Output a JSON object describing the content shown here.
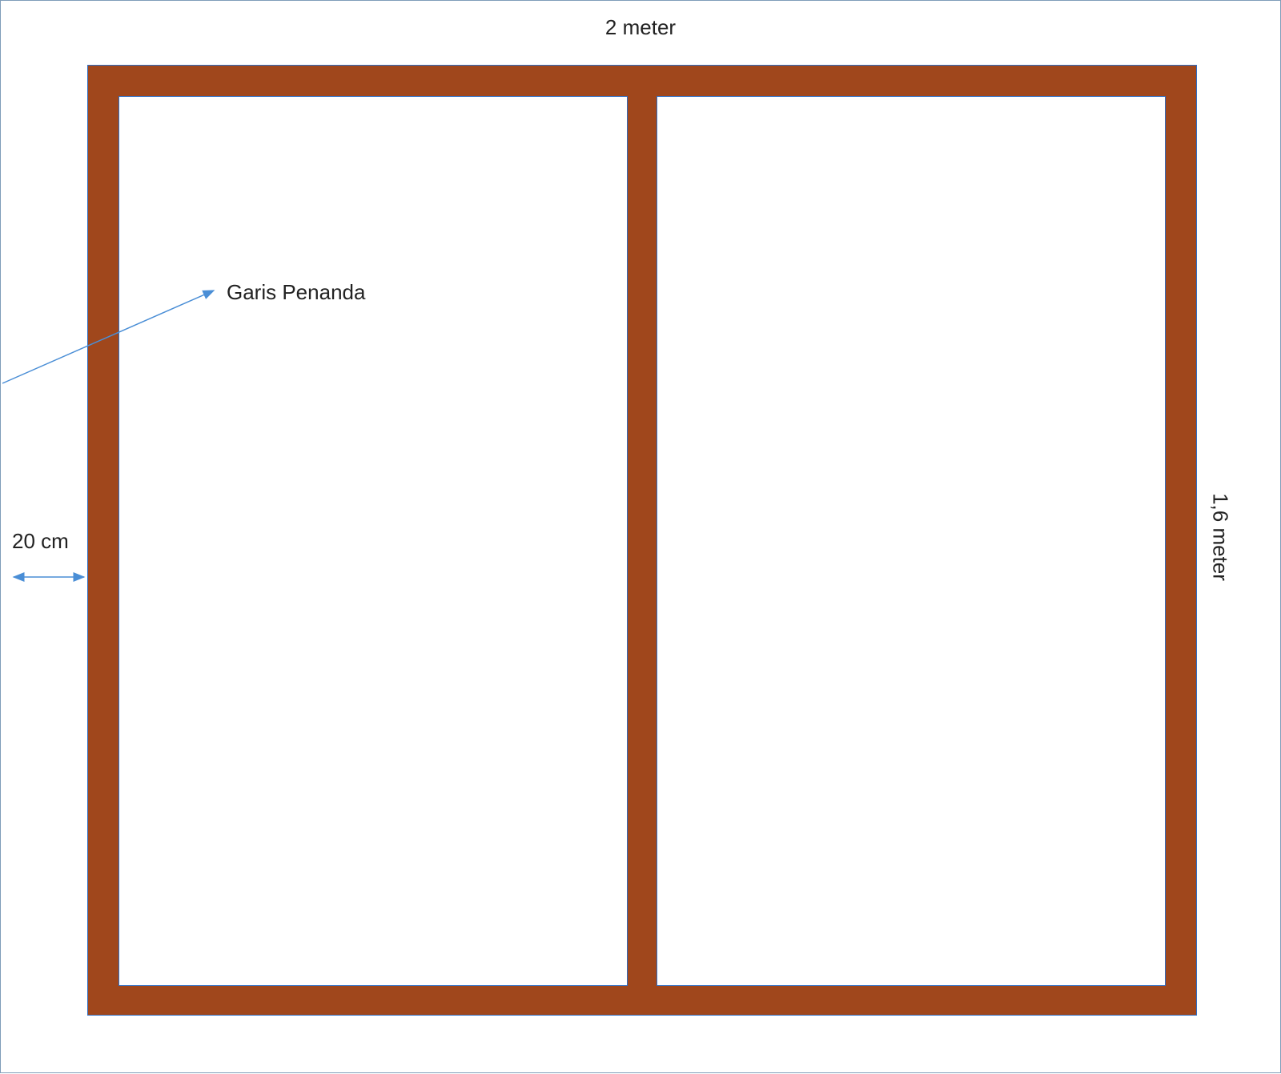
{
  "dimensions": {
    "width_label": "2 meter",
    "height_label": "1,6 meter",
    "frame_thickness_label": "20 cm"
  },
  "annotation": {
    "pointer_label": "Garis Penanda"
  },
  "colors": {
    "frame_fill": "#a0471c",
    "frame_stroke": "#2f6dc2",
    "arrow_stroke": "#4a8ed6",
    "page_border": "#7f9db9"
  }
}
